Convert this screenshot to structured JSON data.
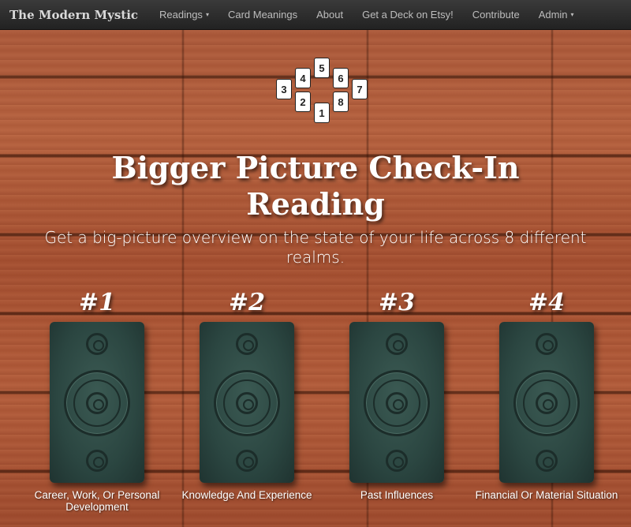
{
  "navbar": {
    "brand": "The Modern Mystic",
    "items": [
      {
        "label": "Readings",
        "dropdown": true
      },
      {
        "label": "Card Meanings",
        "dropdown": false
      },
      {
        "label": "About",
        "dropdown": false
      },
      {
        "label": "Get a Deck on Etsy!",
        "dropdown": false
      },
      {
        "label": "Contribute",
        "dropdown": false
      },
      {
        "label": "Admin",
        "dropdown": true
      }
    ],
    "caret": "▾"
  },
  "spread_icon": {
    "cards": [
      "3",
      "4",
      "5",
      "6",
      "7",
      "2",
      "1",
      "8"
    ]
  },
  "page": {
    "title": "Bigger Picture Check-In Reading",
    "subtitle": "Get a big-picture overview on the state of your life across 8 different realms."
  },
  "cards": [
    {
      "number": "#1",
      "label": "Career, Work, Or Personal Development"
    },
    {
      "number": "#2",
      "label": "Knowledge And Experience"
    },
    {
      "number": "#3",
      "label": "Past Influences"
    },
    {
      "number": "#4",
      "label": "Financial Or Material Situation"
    }
  ],
  "colors": {
    "navbar_bg": "#2b2b2b",
    "card_back": "#2f4a45",
    "wood": "#a9573a"
  }
}
